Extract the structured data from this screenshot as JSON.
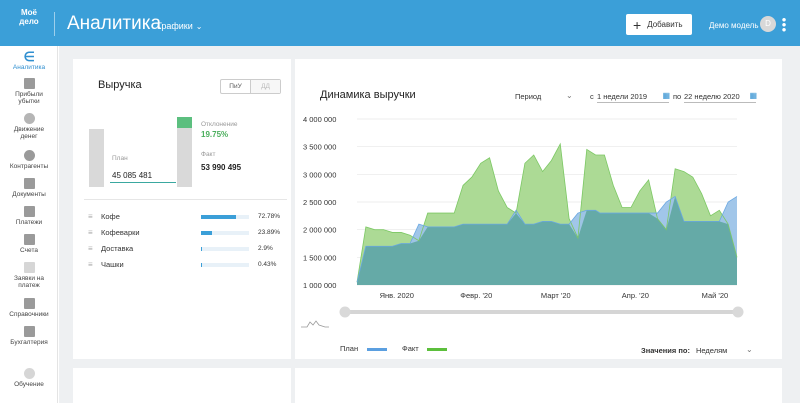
{
  "header": {
    "logo_line1": "Моё",
    "logo_line2": "дело",
    "title": "Аналитика",
    "section": "Графики",
    "add_label": "Добавить",
    "user_name": "Демо модель",
    "avatar_letter": "D"
  },
  "sidebar": {
    "items": [
      {
        "label": "Аналитика",
        "icon": "analytics-icon",
        "active": true
      },
      {
        "label": "Прибыли убытки",
        "icon": "profit-loss-icon"
      },
      {
        "label": "Движение денег",
        "icon": "cash-flow-icon"
      },
      {
        "label": "Контрагенты",
        "icon": "contractors-icon"
      },
      {
        "label": "Документы",
        "icon": "documents-icon"
      },
      {
        "label": "Платежи",
        "icon": "payments-icon"
      },
      {
        "label": "Счета",
        "icon": "invoices-icon"
      },
      {
        "label": "Заявки на платеж",
        "icon": "payment-requests-icon"
      },
      {
        "label": "Справочники",
        "icon": "directories-icon"
      },
      {
        "label": "Бухгалтерия",
        "icon": "accounting-icon"
      },
      {
        "label": "Обучение",
        "icon": "learning-icon"
      }
    ]
  },
  "revenue": {
    "title": "Выручка",
    "toggle_on": "ПиУ",
    "toggle_off": "ДД",
    "plan_label": "План",
    "plan_value": "45 085 481",
    "deviation_label": "Отклонение",
    "deviation_value": "19.75%",
    "fact_label": "Факт",
    "fact_value": "53 990 495",
    "categories": [
      {
        "name": "Кофе",
        "percent": "72.78%",
        "share": 0.7278
      },
      {
        "name": "Кофеварки",
        "percent": "23.89%",
        "share": 0.2389
      },
      {
        "name": "Доставка",
        "percent": "2.9%",
        "share": 0.029
      },
      {
        "name": "Чашки",
        "percent": "0.43%",
        "share": 0.0043
      }
    ]
  },
  "dynamics": {
    "title": "Динамика выручки",
    "period_label": "Период",
    "from_label": "с",
    "from_value": "1 недели 2019",
    "to_label": "по",
    "to_value": "22 неделю 2020",
    "values_by_label": "Значения по:",
    "values_by_value": "Неделям"
  },
  "colors": {
    "accent": "#3b9fd8",
    "plan": "#5b9fe0",
    "fact": "#5cbf3c",
    "plan_fill": "#9cc3e8",
    "fact_fill": "#a8d88f",
    "overlap_fill": "#5fa7a0"
  },
  "chart_data": {
    "type": "area",
    "title": "Динамика выручки",
    "xlabel": "",
    "ylabel": "",
    "ylim": [
      1000000,
      4000000
    ],
    "y_ticks": [
      "4 000 000",
      "3 500 000",
      "3 000 000",
      "2 500 000",
      "2 000 000",
      "1 500 000",
      "1 000 000"
    ],
    "y_tick_values": [
      4000000,
      3500000,
      3000000,
      2500000,
      2000000,
      1500000,
      1000000
    ],
    "x_ticks": [
      "Янв. 2020",
      "Февр. '20",
      "Март '20",
      "Апр. '20",
      "Май '20"
    ],
    "x_tick_positions": [
      4.5,
      13.5,
      22.5,
      31.5,
      40.5
    ],
    "grid": true,
    "legend": "bottom-left",
    "x": [
      0,
      1,
      2,
      3,
      4,
      5,
      6,
      7,
      8,
      9,
      10,
      11,
      12,
      13,
      14,
      15,
      16,
      17,
      18,
      19,
      20,
      21,
      22,
      23,
      24,
      25,
      26,
      27,
      27.5,
      28,
      29,
      30,
      31,
      32,
      33,
      34,
      35,
      36,
      37,
      38,
      39,
      40,
      41,
      42,
      43
    ],
    "series": [
      {
        "name": "План",
        "values": [
          1050000,
          1700000,
          1700000,
          1700000,
          1700000,
          1750000,
          1750000,
          2100000,
          2050000,
          2050000,
          2050000,
          2050000,
          2100000,
          2100000,
          2100000,
          2100000,
          2100000,
          2100000,
          2350000,
          2100000,
          2100000,
          2150000,
          2150000,
          2100000,
          2100000,
          2300000,
          2350000,
          2350000,
          2300000,
          2300000,
          2300000,
          2300000,
          2300000,
          2300000,
          2300000,
          2300000,
          2500000,
          2600000,
          2150000,
          2150000,
          2150000,
          2150000,
          2150000,
          2500000,
          2600000
        ]
      },
      {
        "name": "Факт",
        "values": [
          1050000,
          2050000,
          2000000,
          2000000,
          1950000,
          1950000,
          1900000,
          1800000,
          2300000,
          2300000,
          2300000,
          2300000,
          2800000,
          2950000,
          3200000,
          3300000,
          2700000,
          2400000,
          2300000,
          3200000,
          3350000,
          3050000,
          3250000,
          3550000,
          2200000,
          1850000,
          3450000,
          3350000,
          3350000,
          3350000,
          2800000,
          2400000,
          2400000,
          2700000,
          2900000,
          2200000,
          2000000,
          3100000,
          3050000,
          2950000,
          2650000,
          2250000,
          2350000,
          2100000,
          1500000
        ]
      }
    ]
  }
}
